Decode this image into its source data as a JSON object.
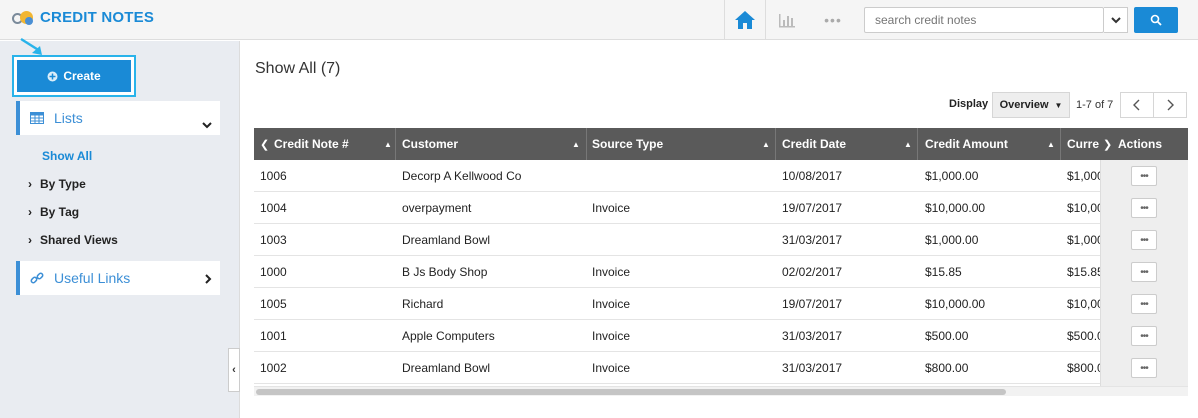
{
  "header": {
    "title": "CREDIT NOTES",
    "logo_icon": "apptivo-logo-icon",
    "home_icon": "home-icon",
    "chart_icon": "bar-chart-icon",
    "more_icon": "more-dots-icon",
    "more_label": "•••",
    "search_placeholder": "search credit notes",
    "search_icon": "search-icon",
    "accent_color": "#1a8ad6"
  },
  "sidebar": {
    "create_label": "Create",
    "lists_label": "Lists",
    "show_all_label": "Show All",
    "nav_items": [
      {
        "label": "By Type"
      },
      {
        "label": "By Tag"
      },
      {
        "label": "Shared Views"
      }
    ],
    "useful_links_label": "Useful Links"
  },
  "main": {
    "title": "Show All (7)",
    "display_label": "Display",
    "view_selected": "Overview",
    "paging_text": "1-7 of 7",
    "columns": [
      "Credit Note #",
      "Customer",
      "Source Type",
      "Credit Date",
      "Credit Amount",
      "Curre",
      "Actions"
    ],
    "actions_label": "•••",
    "rows": [
      {
        "number": "1006",
        "customer": "Decorp A Kellwood Co",
        "source": "",
        "date": "10/08/2017",
        "amount": "$1,000.00",
        "currency": "$1,000"
      },
      {
        "number": "1004",
        "customer": "overpayment",
        "source": "Invoice",
        "date": "19/07/2017",
        "amount": "$10,000.00",
        "currency": "$10,00"
      },
      {
        "number": "1003",
        "customer": "Dreamland Bowl",
        "source": "",
        "date": "31/03/2017",
        "amount": "$1,000.00",
        "currency": "$1,000"
      },
      {
        "number": "1000",
        "customer": "B Js Body Shop",
        "source": "Invoice",
        "date": "02/02/2017",
        "amount": "$15.85",
        "currency": "$15.85"
      },
      {
        "number": "1005",
        "customer": "Richard",
        "source": "Invoice",
        "date": "19/07/2017",
        "amount": "$10,000.00",
        "currency": "$10,00"
      },
      {
        "number": "1001",
        "customer": "Apple Computers",
        "source": "Invoice",
        "date": "31/03/2017",
        "amount": "$500.00",
        "currency": "$500.0"
      },
      {
        "number": "1002",
        "customer": "Dreamland Bowl",
        "source": "Invoice",
        "date": "31/03/2017",
        "amount": "$800.00",
        "currency": "$800.0"
      }
    ]
  }
}
